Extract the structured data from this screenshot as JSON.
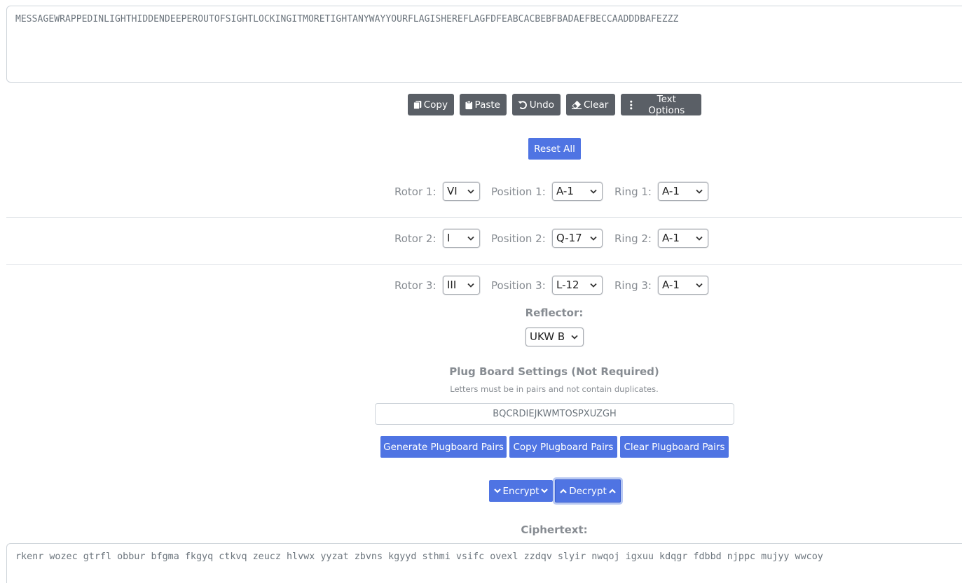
{
  "input_text": "MESSAGEWRAPPEDINLIGHTHIDDENDEEPEROUTOFSIGHTLOCKINGITMORETIGHTANYWAYYOURFLAGISHEREFLAGFDFEABCACBEBFBADAEFBECCAADDDBAFEZZZ",
  "toolbar": {
    "copy": "Copy",
    "paste": "Paste",
    "undo": "Undo",
    "clear": "Clear",
    "text_options": "Text Options"
  },
  "reset_all": "Reset All",
  "rotors": [
    {
      "rotor_label": "Rotor 1:",
      "rotor_value": "VI",
      "position_label": "Position 1:",
      "position_value": "A-1",
      "ring_label": "Ring 1:",
      "ring_value": "A-1"
    },
    {
      "rotor_label": "Rotor 2:",
      "rotor_value": "I",
      "position_label": "Position 2:",
      "position_value": "Q-17",
      "ring_label": "Ring 2:",
      "ring_value": "A-1"
    },
    {
      "rotor_label": "Rotor 3:",
      "rotor_value": "III",
      "position_label": "Position 3:",
      "position_value": "L-12",
      "ring_label": "Ring 3:",
      "ring_value": "A-1"
    }
  ],
  "reflector": {
    "label": "Reflector:",
    "value": "UKW B"
  },
  "plugboard": {
    "title": "Plug Board Settings (Not Required)",
    "note": "Letters must be in pairs and not contain duplicates.",
    "value": "BQCRDIEJKWMTOSPXUZGH",
    "generate": "Generate Plugboard Pairs",
    "copy": "Copy Plugboard Pairs",
    "clear": "Clear Plugboard Pairs"
  },
  "modes": {
    "encrypt": "Encrypt",
    "decrypt": "Decrypt"
  },
  "ciphertext": {
    "label": "Ciphertext:",
    "value": "rkenr wozec gtrfl obbur bfgma fkgyq ctkvq zeucz hlvwx yyzat zbvns kgyyd sthmi vsifc ovexl zzdqv slyir nwqoj igxuu kdqgr fdbbd njppc mujyy wwcoy"
  },
  "colors": {
    "primary": "#4f74e3",
    "secondary": "#5a5f66",
    "label_gray": "#878c92"
  }
}
